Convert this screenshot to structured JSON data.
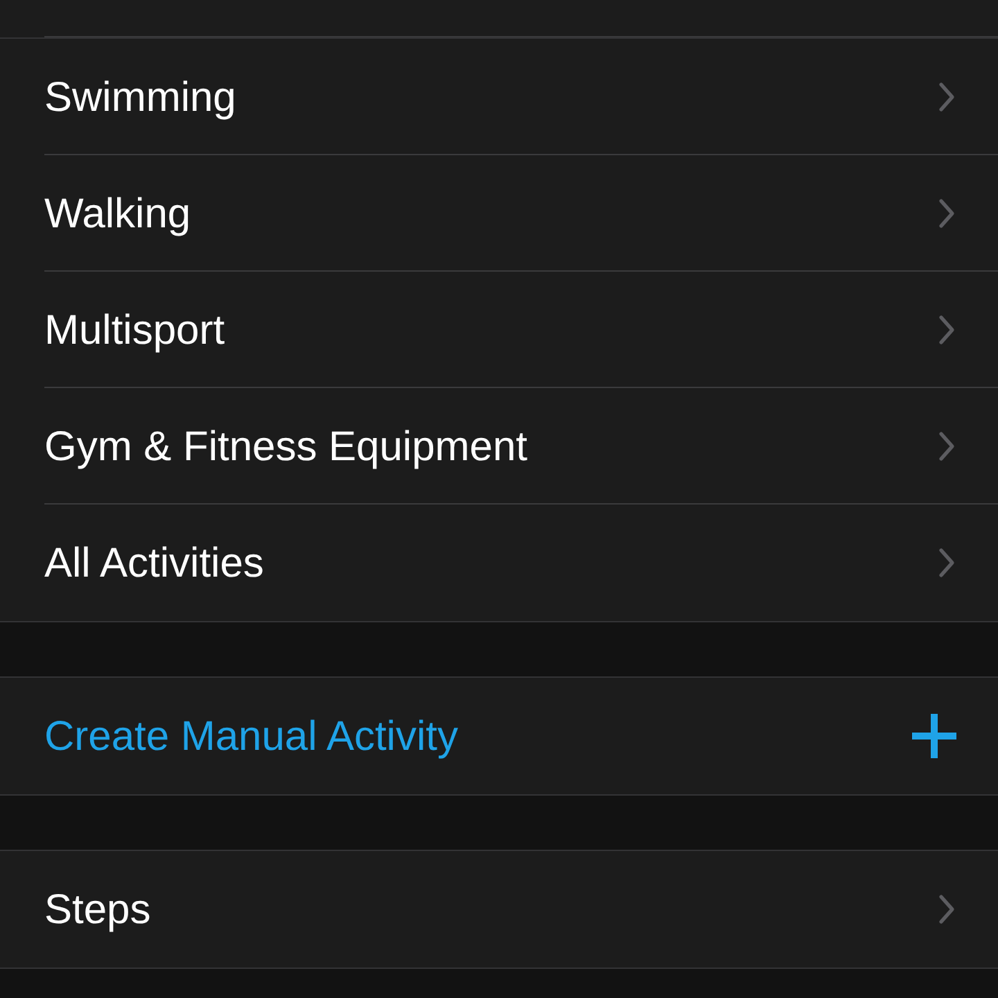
{
  "sections": [
    {
      "rows": [
        {
          "kind": "nav",
          "label": "Swimming"
        },
        {
          "kind": "nav",
          "label": "Walking"
        },
        {
          "kind": "nav",
          "label": "Multisport"
        },
        {
          "kind": "nav",
          "label": "Gym & Fitness Equipment"
        },
        {
          "kind": "nav",
          "label": "All Activities"
        }
      ]
    },
    {
      "rows": [
        {
          "kind": "action",
          "label": "Create Manual Activity"
        }
      ]
    },
    {
      "rows": [
        {
          "kind": "nav",
          "label": "Steps"
        }
      ]
    }
  ]
}
